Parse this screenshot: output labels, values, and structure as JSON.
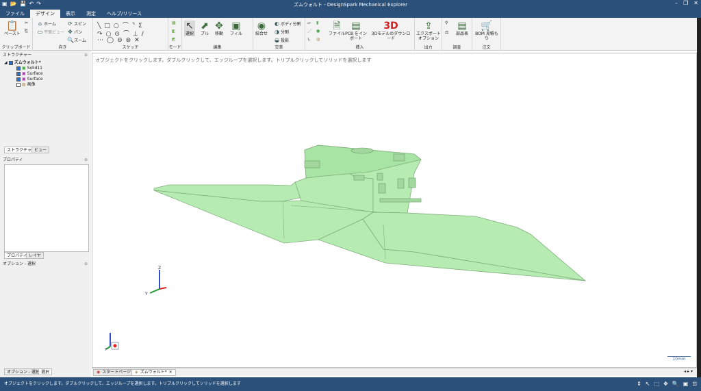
{
  "window": {
    "title": "ズムウォルト - DesignSpark Mechanical Explorer"
  },
  "menu_tabs": [
    "ファイル",
    "デザイン",
    "表示",
    "測定",
    "ヘルプ/リリース"
  ],
  "ribbon": {
    "clipboard": {
      "label": "クリップボード",
      "paste": "ペースト"
    },
    "orient": {
      "label": "向き",
      "home": "ホーム",
      "plane_view": "平面ビュー",
      "spin": "スピン",
      "pan": "パン",
      "zoom": "ズーム"
    },
    "sketch": {
      "label": "スケッチ"
    },
    "mode": {
      "label": "モード"
    },
    "edit": {
      "label": "編集",
      "select": "選択",
      "pull": "プル",
      "move": "移動",
      "fill": "フィル"
    },
    "intersect": {
      "label": "交差",
      "combine": "結合せ",
      "body_split": "ボディ分割",
      "split": "分割",
      "project": "投影"
    },
    "insert": {
      "label": "挿入",
      "file": "ファイル",
      "pcb": "PCB をインポート",
      "download": "3Dモデルのダウンロード"
    },
    "output": {
      "label": "出力",
      "export": "エクスポート オプション"
    },
    "investigate": {
      "label": "調査",
      "parts": "部品表"
    },
    "order": {
      "label": "注文",
      "bom": "BOM 見積もり"
    }
  },
  "structure": {
    "header": "ストラクチャー",
    "root": "ズムウォルト*",
    "items": [
      {
        "name": "Solid11",
        "checked": true
      },
      {
        "name": "Surface",
        "checked": true
      },
      {
        "name": "Surface",
        "checked": true
      },
      {
        "name": "画像",
        "checked": false
      }
    ],
    "tabs": [
      "ストラクチャー",
      "ビュー"
    ]
  },
  "properties": {
    "header": "プロパティ",
    "tabs": [
      "プロパティ",
      "レイヤ"
    ]
  },
  "options": {
    "header": "オプション - 選択",
    "tabs": [
      "オプション - 選択",
      "選択"
    ]
  },
  "viewport": {
    "hint": "オブジェクトをクリックします。ダブルクリックして、エッジループを選択します。トリプルクリックしてソリッドを選択します",
    "scale_label": "10mm",
    "model_color": "#b6ecb2",
    "axes": {
      "x": "X",
      "y": "Y",
      "z": "Z"
    }
  },
  "doc_tabs": [
    {
      "label": "スタートページ",
      "active": false
    },
    {
      "label": "ズムウォルト*",
      "active": true
    }
  ],
  "status": {
    "text": "オブジェクトをクリックします。ダブルクリックして、エッジループを選択します。トリプルクリックしてソリッドを選択します"
  },
  "colors": {
    "chrome": "#2b5079",
    "ribbon": "#f3f3f3"
  }
}
